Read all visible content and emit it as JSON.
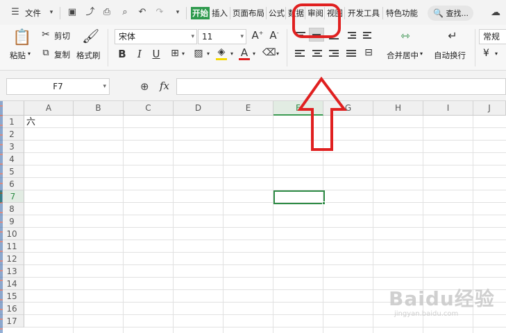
{
  "menubar": {
    "file_menu": "文件",
    "tabs": [
      "开始",
      "插入",
      "页面布局",
      "公式",
      "数据",
      "审阅",
      "视图",
      "开发工具",
      "特色功能"
    ],
    "active_tab": "开始",
    "search_placeholder": "查找..."
  },
  "ribbon": {
    "paste": "粘贴",
    "cut": "剪切",
    "copy": "复制",
    "format_painter": "格式刷",
    "font_name": "宋体",
    "font_size": "11",
    "merge_center": "合并居中",
    "wrap_text": "自动换行",
    "number_format": "常规",
    "currency_symbol": "¥"
  },
  "formula_bar": {
    "cell_reference": "F7",
    "fx_label": "fx",
    "formula_value": ""
  },
  "sheet": {
    "columns": [
      "A",
      "B",
      "C",
      "D",
      "E",
      "F",
      "G",
      "H",
      "I",
      "J"
    ],
    "rows": [
      "1",
      "2",
      "3",
      "4",
      "5",
      "6",
      "7",
      "8",
      "9",
      "10",
      "11",
      "12",
      "13",
      "14",
      "15",
      "16",
      "17"
    ],
    "selected_column": "F",
    "selected_row": "7",
    "cell_a1": "六"
  },
  "watermark": {
    "brand": "Baidu经验",
    "url": "jingyan.baidu.com"
  },
  "colors": {
    "accent_green": "#2e9a4d",
    "annotation_red": "#e02020"
  },
  "annotation": {
    "description_icons": [
      "red-rounded-rectangle",
      "red-up-arrow"
    ]
  }
}
